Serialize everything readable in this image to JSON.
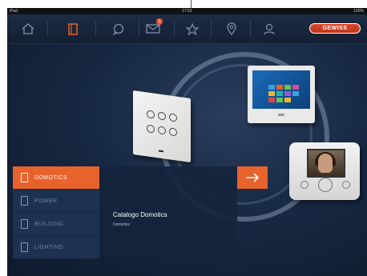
{
  "status_bar": {
    "carrier": "iPad",
    "time": "17:52",
    "battery": "100%"
  },
  "nav": {
    "items": [
      {
        "name": "home-icon"
      },
      {
        "name": "document-icon"
      },
      {
        "name": "chat-icon"
      },
      {
        "name": "mail-icon",
        "badge": "1"
      },
      {
        "name": "star-icon"
      },
      {
        "name": "location-icon"
      },
      {
        "name": "user-icon"
      }
    ],
    "brand": "GEWISS"
  },
  "menu": {
    "items": [
      {
        "label": "DOMOTICS",
        "active": true
      },
      {
        "label": "POWER",
        "active": false
      },
      {
        "label": "BUILDING",
        "active": false
      },
      {
        "label": "LIGHTING",
        "active": false
      }
    ]
  },
  "detail": {
    "title": "Catalogo Domotics",
    "subtitle": "Domotics"
  },
  "colors": {
    "accent": "#e8622c",
    "background": "#172842",
    "brand": "#c63d1e"
  }
}
